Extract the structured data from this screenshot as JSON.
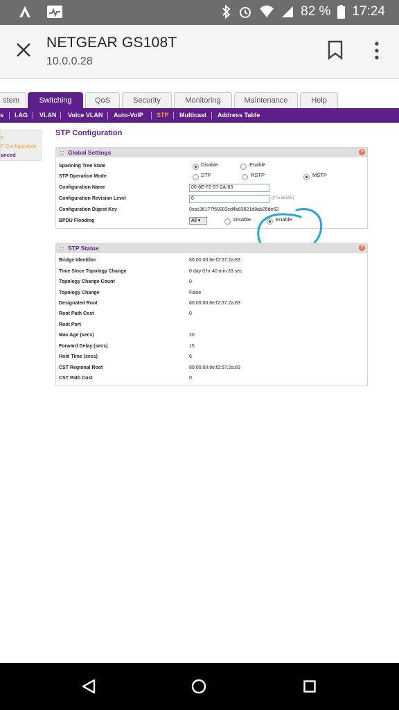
{
  "status_bar": {
    "battery_percent": "82 %",
    "time": "17:24"
  },
  "app_bar": {
    "title": "NETGEAR GS108T",
    "subtitle": "10.0.0.28"
  },
  "main_tabs": [
    {
      "label": "stem"
    },
    {
      "label": "Switching"
    },
    {
      "label": "QoS"
    },
    {
      "label": "Security"
    },
    {
      "label": "Monitoring"
    },
    {
      "label": "Maintenance"
    },
    {
      "label": "Help"
    }
  ],
  "sub_tabs": [
    {
      "label": "s"
    },
    {
      "label": "LAG"
    },
    {
      "label": "VLAN"
    },
    {
      "label": "Voice VLAN"
    },
    {
      "label": "Auto-VoIP"
    },
    {
      "label": "STP"
    },
    {
      "label": "Multicast"
    },
    {
      "label": "Address Table"
    }
  ],
  "left_nav": [
    "e",
    "P Configuration",
    "anced"
  ],
  "page_title": "STP Configuration",
  "global_settings": {
    "heading": "Global Settings",
    "help": "?",
    "spanning_tree_state": {
      "label": "Spanning Tree State",
      "opt_disable": "Disable",
      "opt_enable": "Enable",
      "selected": "Disable"
    },
    "operation_mode": {
      "label": "STP Operation Mode",
      "opt_stp": "STP",
      "opt_rstp": "RSTP",
      "opt_mstp": "MSTP",
      "selected": "MSTP"
    },
    "config_name": {
      "label": "Configuration Name",
      "value": "00-8E-F2-57-2A-83"
    },
    "revision": {
      "label": "Configuration Revision Level",
      "value": "0",
      "hint": "(0 to 65535)"
    },
    "digest": {
      "label": "Configuration Digest Key",
      "value": "0xac36177f50283cd4b83821d8ab26de62"
    },
    "bpdu": {
      "label": "BPDU Flooding",
      "select_value": "All ▾",
      "opt_disable": "Disable",
      "opt_enable": "Enable",
      "selected": "Enable"
    }
  },
  "stp_status": {
    "heading": "STP Status",
    "help": "?",
    "rows": [
      {
        "label": "Bridge Identifier",
        "value": "80:00:00:8e:f2:57:2a:83"
      },
      {
        "label": "Time Since Topology Change",
        "value": "0 day 0 hr 40 min 33 sec"
      },
      {
        "label": "Topology Change Count",
        "value": "0"
      },
      {
        "label": "Topology Change",
        "value": "False"
      },
      {
        "label": "Designated Root",
        "value": "80:00:00:8e:f2:57:2a:83"
      },
      {
        "label": "Root Path Cost",
        "value": "0"
      },
      {
        "label": "Root Port",
        "value": ""
      },
      {
        "label": "Max Age (secs)",
        "value": "20"
      },
      {
        "label": "Forward Delay (secs)",
        "value": "15"
      },
      {
        "label": "Hold Time (secs)",
        "value": "6"
      },
      {
        "label": "CST Regional Root",
        "value": "80:00:00:8e:f2:57:2a:83"
      },
      {
        "label": "CST Path Cost",
        "value": "0"
      }
    ]
  },
  "colors": {
    "brand_purple": "#5e1f8c",
    "active_subtab": "#f0a020",
    "annotation": "#1ea8e0"
  }
}
